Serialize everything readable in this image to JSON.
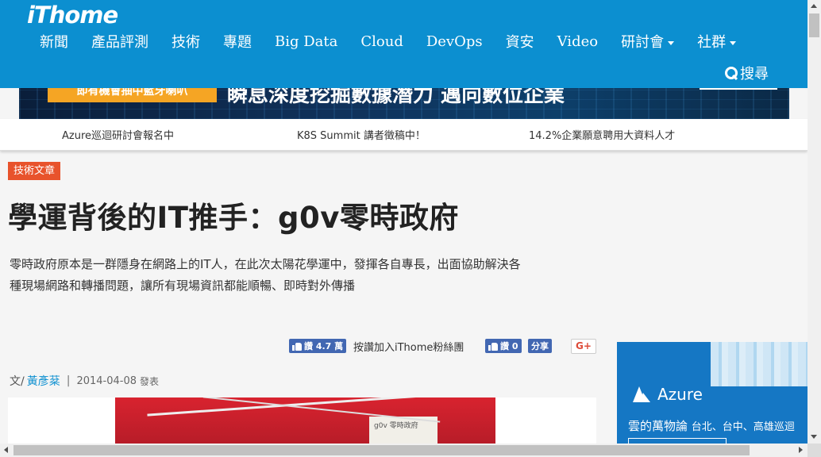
{
  "header": {
    "logo": "iThome",
    "nav": [
      {
        "label": "新聞",
        "dropdown": false
      },
      {
        "label": "產品評測",
        "dropdown": false
      },
      {
        "label": "技術",
        "dropdown": false
      },
      {
        "label": "專題",
        "dropdown": false
      },
      {
        "label": "Big Data",
        "dropdown": false
      },
      {
        "label": "Cloud",
        "dropdown": false
      },
      {
        "label": "DevOps",
        "dropdown": false
      },
      {
        "label": "資安",
        "dropdown": false
      },
      {
        "label": "Video",
        "dropdown": false
      },
      {
        "label": "研討會",
        "dropdown": true
      },
      {
        "label": "社群",
        "dropdown": true
      }
    ],
    "search_label": "搜尋"
  },
  "banner": {
    "badge_text": "即有機會抽中藍牙喇叭",
    "main_text": "瞬息深度挖掘數據潛力 邁向數位企業"
  },
  "ticker": [
    "Azure巡迴研討會報名中",
    "K8S Summit 講者徵稿中！",
    "14.2%企業願意聘用大資料人才"
  ],
  "article": {
    "category": "技術文章",
    "title": "學運背後的IT推手：g0v零時政府",
    "summary": "零時政府原本是一群隱身在網路上的IT人，在此次太陽花學運中，發揮各自專長，出面協助解決各種現場網路和轉播問題，讓所有現場資訊都能順暢、即時對外傳播",
    "author_prefix": "文/",
    "author": "黃彥棻",
    "date": "2014-04-08",
    "date_suffix": "發表",
    "image_board_text": "g0v 零時政府"
  },
  "social": {
    "like_page_label": "讚",
    "like_page_count": "4.7 萬",
    "like_page_text": "按讚加入iThome粉絲團",
    "like_label": "讚",
    "like_count": "0",
    "share_label": "分享",
    "gplus_label": "G+"
  },
  "ad": {
    "brand": "Azure",
    "headline": "雲的萬物論",
    "cities": "台北、台中、高雄巡迴"
  },
  "colors": {
    "header_bg": "#0c8fd0",
    "tag_bg": "#e8532c",
    "facebook": "#4267b2",
    "ad_bg": "#1577c4"
  }
}
